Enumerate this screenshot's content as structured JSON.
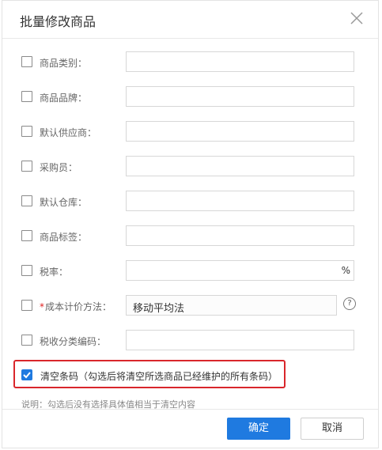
{
  "dialog": {
    "title": "批量修改商品",
    "close_icon": "close-icon"
  },
  "fields": [
    {
      "label": "商品类别：",
      "value": ""
    },
    {
      "label": "商品品牌：",
      "value": ""
    },
    {
      "label": "默认供应商：",
      "value": ""
    },
    {
      "label": "采购员：",
      "value": ""
    },
    {
      "label": "默认仓库：",
      "value": ""
    },
    {
      "label": "商品标签：",
      "value": ""
    },
    {
      "label": "税率：",
      "value": "",
      "suffix": "%"
    },
    {
      "label": "成本计价方法：",
      "required_mark": "*",
      "value": "移动平均法",
      "help_icon": "question-circle-icon",
      "help_glyph": "?"
    },
    {
      "label": "税收分类编码：",
      "value": ""
    }
  ],
  "clear_barcode": {
    "checked": true,
    "label": "清空条码（勾选后将清空所选商品已经维护的所有条码）"
  },
  "note": "说明：勾选后没有选择具体值相当于清空内容",
  "footer": {
    "ok_label": "确定",
    "cancel_label": "取消"
  },
  "colors": {
    "accent": "#1f7ae0",
    "highlight_border": "#d9262b",
    "required": "#e02020"
  }
}
